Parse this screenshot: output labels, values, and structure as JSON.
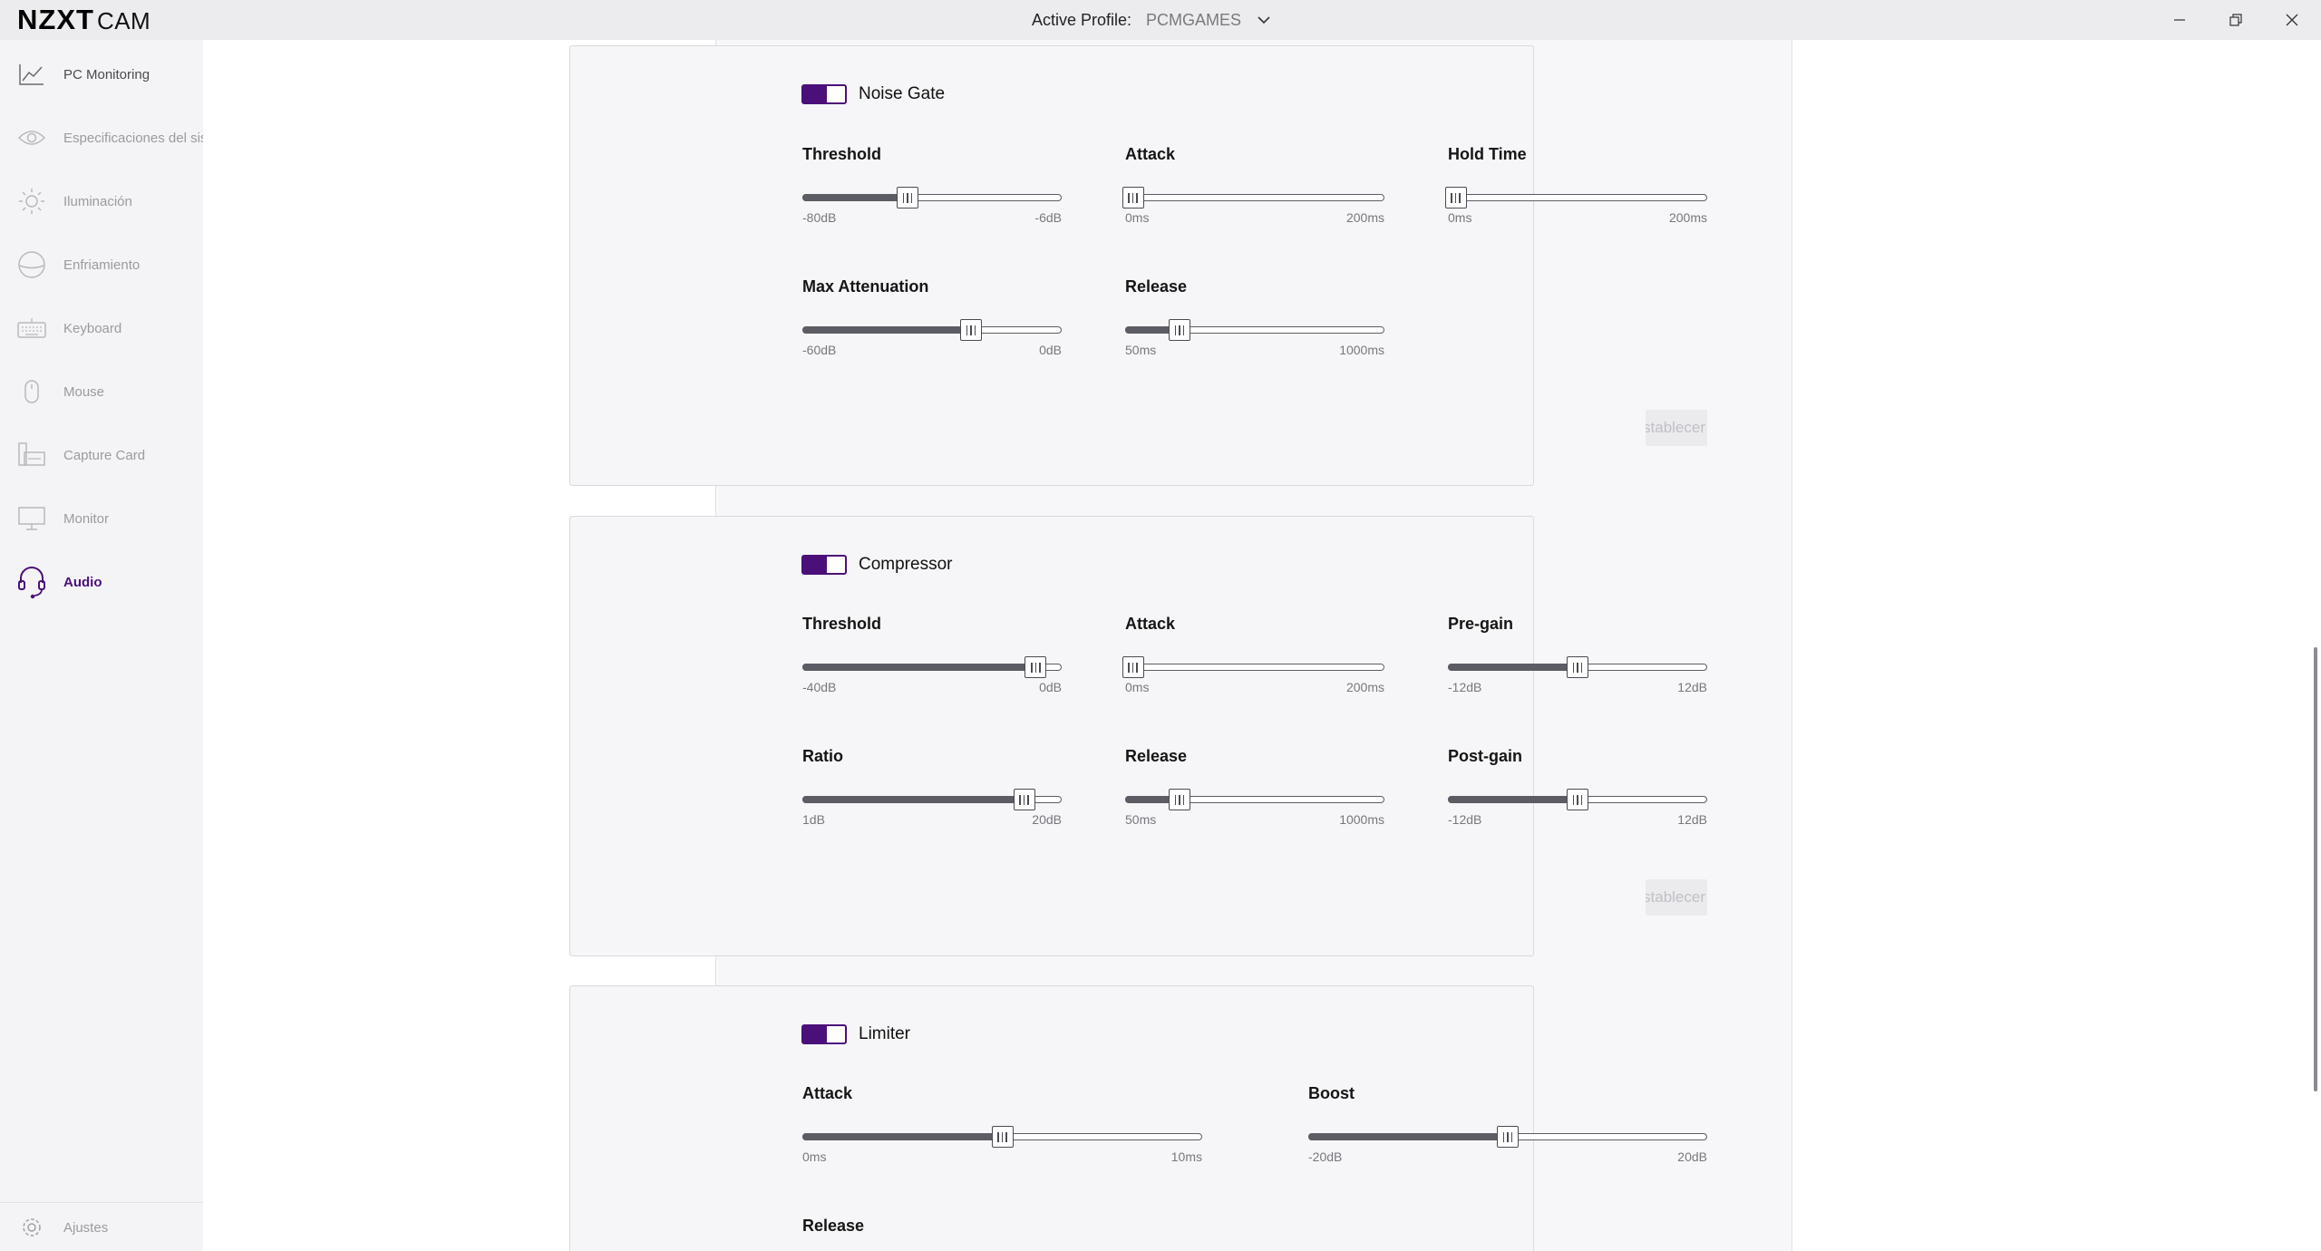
{
  "titlebar": {
    "brand": "NZXT",
    "product": "CAM",
    "profile_label": "Active Profile:",
    "profile_value": "PCMGAMES"
  },
  "sidebar": {
    "items": [
      {
        "label": "PC Monitoring",
        "icon": "chart-line-icon"
      },
      {
        "label": "Especificaciones del sistema",
        "icon": "eye-icon"
      },
      {
        "label": "Iluminación",
        "icon": "sun-icon"
      },
      {
        "label": "Enfriamiento",
        "icon": "fan-icon"
      },
      {
        "label": "Keyboard",
        "icon": "keyboard-icon"
      },
      {
        "label": "Mouse",
        "icon": "mouse-icon"
      },
      {
        "label": "Capture Card",
        "icon": "capture-card-icon"
      },
      {
        "label": "Monitor",
        "icon": "monitor-icon"
      },
      {
        "label": "Audio",
        "icon": "headset-icon"
      }
    ],
    "active": "Audio",
    "settings_label": "Ajustes"
  },
  "panels": {
    "noise_gate": {
      "title": "Noise Gate",
      "enabled": true,
      "reset_label": "Restablecer",
      "sliders": {
        "threshold": {
          "label": "Threshold",
          "min": "-80dB",
          "max": "-6dB",
          "fraction": 0.405
        },
        "attack": {
          "label": "Attack",
          "min": "0ms",
          "max": "200ms",
          "fraction": 0.03
        },
        "hold_time": {
          "label": "Hold Time",
          "min": "0ms",
          "max": "200ms",
          "fraction": 0.03
        },
        "max_attenuation": {
          "label": "Max Attenuation",
          "min": "-60dB",
          "max": "0dB",
          "fraction": 0.65
        },
        "release": {
          "label": "Release",
          "min": "50ms",
          "max": "1000ms",
          "fraction": 0.21
        }
      }
    },
    "compressor": {
      "title": "Compressor",
      "enabled": true,
      "reset_label": "Restablecer",
      "sliders": {
        "threshold": {
          "label": "Threshold",
          "min": "-40dB",
          "max": "0dB",
          "fraction": 0.9
        },
        "attack": {
          "label": "Attack",
          "min": "0ms",
          "max": "200ms",
          "fraction": 0.03
        },
        "pre_gain": {
          "label": "Pre-gain",
          "min": "-12dB",
          "max": "12dB",
          "fraction": 0.5
        },
        "ratio": {
          "label": "Ratio",
          "min": "1dB",
          "max": "20dB",
          "fraction": 0.855
        },
        "release": {
          "label": "Release",
          "min": "50ms",
          "max": "1000ms",
          "fraction": 0.21
        },
        "post_gain": {
          "label": "Post-gain",
          "min": "-12dB",
          "max": "12dB",
          "fraction": 0.5
        }
      }
    },
    "limiter": {
      "title": "Limiter",
      "enabled": true,
      "sliders": {
        "attack": {
          "label": "Attack",
          "min": "0ms",
          "max": "10ms",
          "fraction": 0.5
        },
        "boost": {
          "label": "Boost",
          "min": "-20dB",
          "max": "20dB",
          "fraction": 0.5
        },
        "release": {
          "label": "Release"
        }
      }
    }
  },
  "colors": {
    "accent": "#4b0f7a",
    "track": "#5c5c64"
  }
}
